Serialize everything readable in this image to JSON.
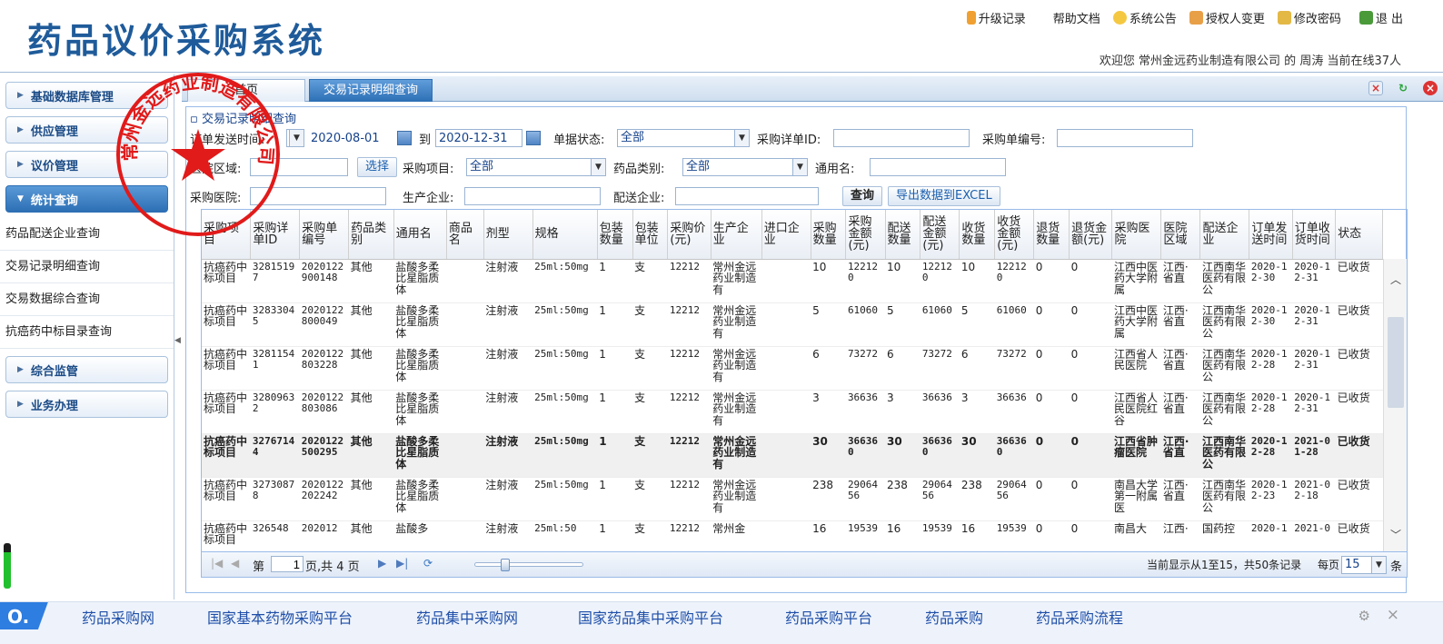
{
  "header": {
    "logo": "药品议价采购系统",
    "links": [
      {
        "label": "升级记录",
        "icon": "upgrade-icon"
      },
      {
        "label": "帮助文档",
        "icon": ""
      },
      {
        "label": "系统公告",
        "icon": "bulb-icon"
      },
      {
        "label": "授权人变更",
        "icon": "user-switch-icon"
      },
      {
        "label": "修改密码",
        "icon": "password-icon"
      },
      {
        "label": "退 出",
        "icon": "exit-icon"
      }
    ],
    "welcome": "欢迎您 常州金远药业制造有限公司 的 周涛  当前在线37人"
  },
  "sidebar": {
    "groups_top": [
      "基础数据库管理",
      "供应管理",
      "议价管理"
    ],
    "active_group": "统计查询",
    "sub_items": [
      "药品配送企业查询",
      "交易记录明细查询",
      "交易数据综合查询",
      "抗癌药中标目录查询"
    ],
    "groups_bottom": [
      "综合监管",
      "业务办理"
    ]
  },
  "tabs": {
    "home": "首页",
    "active": "交易记录明细查询"
  },
  "panel": {
    "title": "交易记录明细查询",
    "filters": {
      "order_time_label": "订单发送时间:",
      "date_from": "2020-08-01",
      "to_label": "到",
      "date_to": "2020-12-31",
      "doc_status_label": "单据状态:",
      "doc_status_value": "全部",
      "detail_id_label": "采购详单ID:",
      "detail_id_value": "",
      "order_no_label": "采购单编号:",
      "order_no_value": "",
      "hospital_region_label": "医院区域:",
      "hospital_region_value": "",
      "select_btn": "选择",
      "purchase_item_label": "采购项目:",
      "purchase_item_value": "全部",
      "drug_cat_label": "药品类别:",
      "drug_cat_value": "全部",
      "generic_name_label": "通用名:",
      "generic_name_value": "",
      "hospital_label": "采购医院:",
      "hospital_value": "",
      "manufacturer_label": "生产企业:",
      "manufacturer_value": "",
      "distributor_label": "配送企业:",
      "distributor_value": "",
      "query_btn": "查询",
      "export_btn": "导出数据到EXCEL"
    },
    "columns": [
      "采购项目",
      "采购详单ID",
      "采购单编号",
      "药品类别",
      "通用名",
      "商品名",
      "剂型",
      "规格",
      "包装数量",
      "包装单位",
      "采购价(元)",
      "生产企业",
      "进口企业",
      "采购数量",
      "采购金额(元)",
      "配送数量",
      "配送金额(元)",
      "收货数量",
      "收货金额(元)",
      "退货数量",
      "退货金额(元)",
      "采购医院",
      "医院区域",
      "配送企业",
      "订单发送时间",
      "订单收货时间",
      "状态"
    ],
    "rows": [
      [
        "抗癌药中标项目",
        "32815197",
        "2020122900148",
        "其他",
        "盐酸多柔比星脂质体",
        "",
        "注射液",
        "25ml:50mg",
        "1",
        "支",
        "12212",
        "常州金远药业制造有",
        "",
        "10",
        "122120",
        "10",
        "122120",
        "10",
        "122120",
        "0",
        "0",
        "江西中医药大学附属",
        "江西·省直",
        "江西南华医药有限公",
        "2020-12-30",
        "2020-12-31",
        "已收货"
      ],
      [
        "抗癌药中标项目",
        "32833045",
        "2020122800049",
        "其他",
        "盐酸多柔比星脂质体",
        "",
        "注射液",
        "25ml:50mg",
        "1",
        "支",
        "12212",
        "常州金远药业制造有",
        "",
        "5",
        "61060",
        "5",
        "61060",
        "5",
        "61060",
        "0",
        "0",
        "江西中医药大学附属",
        "江西·省直",
        "江西南华医药有限公",
        "2020-12-30",
        "2020-12-31",
        "已收货"
      ],
      [
        "抗癌药中标项目",
        "32811541",
        "2020122803228",
        "其他",
        "盐酸多柔比星脂质体",
        "",
        "注射液",
        "25ml:50mg",
        "1",
        "支",
        "12212",
        "常州金远药业制造有",
        "",
        "6",
        "73272",
        "6",
        "73272",
        "6",
        "73272",
        "0",
        "0",
        "江西省人民医院",
        "江西·省直",
        "江西南华医药有限公",
        "2020-12-28",
        "2020-12-31",
        "已收货"
      ],
      [
        "抗癌药中标项目",
        "32809632",
        "2020122803086",
        "其他",
        "盐酸多柔比星脂质体",
        "",
        "注射液",
        "25ml:50mg",
        "1",
        "支",
        "12212",
        "常州金远药业制造有",
        "",
        "3",
        "36636",
        "3",
        "36636",
        "3",
        "36636",
        "0",
        "0",
        "江西省人民医院红谷",
        "江西·省直",
        "江西南华医药有限公",
        "2020-12-28",
        "2020-12-31",
        "已收货"
      ],
      [
        "抗癌药中标项目",
        "32767144",
        "2020122500295",
        "其他",
        "盐酸多柔比星脂质体",
        "",
        "注射液",
        "25ml:50mg",
        "1",
        "支",
        "12212",
        "常州金远药业制造有",
        "",
        "30",
        "366360",
        "30",
        "366360",
        "30",
        "366360",
        "0",
        "0",
        "江西省肿瘤医院",
        "江西·省直",
        "江西南华医药有限公",
        "2020-12-28",
        "2021-01-28",
        "已收货"
      ],
      [
        "抗癌药中标项目",
        "32730878",
        "2020122202242",
        "其他",
        "盐酸多柔比星脂质体",
        "",
        "注射液",
        "25ml:50mg",
        "1",
        "支",
        "12212",
        "常州金远药业制造有",
        "",
        "238",
        "2906456",
        "238",
        "2906456",
        "238",
        "2906456",
        "0",
        "0",
        "南昌大学第一附属医",
        "江西·省直",
        "江西南华医药有限公",
        "2020-12-23",
        "2021-02-18",
        "已收货"
      ],
      [
        "抗癌药中标项目",
        "326548",
        "202012",
        "其他",
        "盐酸多",
        "",
        "注射液",
        "25ml:50",
        "1",
        "支",
        "12212",
        "常州金",
        "",
        "16",
        "19539",
        "16",
        "19539",
        "16",
        "19539",
        "0",
        "0",
        "南昌大",
        "江西·",
        "国药控",
        "2020-1",
        "2021-0",
        "已收货"
      ]
    ],
    "selected_row": 4,
    "pager": {
      "page_label": "第",
      "page_value": "1",
      "page_suffix": "页,共 4 页",
      "summary": "当前显示从1至15，共50条记录",
      "per_page_label": "每页",
      "per_page_value": "15",
      "unit": "条",
      "slider_fraction": 0.25
    }
  },
  "stamp": {
    "text": "常州金远药业制造有限公司"
  },
  "bottombar": {
    "logo": "O.",
    "links": [
      "药品采购网",
      "国家基本药物采购平台",
      "药品集中采购网",
      "国家药品集中采购平台",
      "药品采购平台",
      "药品采购",
      "药品采购流程"
    ]
  },
  "colors": {
    "brand": "#1f5b9a",
    "tab_active": "#2f71b6",
    "stamp": "#e11a1a",
    "link": "#1f4fa8"
  }
}
